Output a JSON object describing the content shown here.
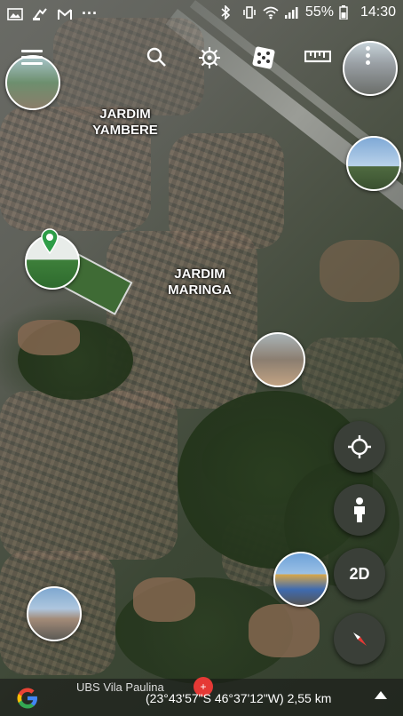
{
  "status_bar": {
    "battery": "55%",
    "time": "14:30",
    "overflow": "···"
  },
  "toolbar": {
    "icons": [
      "menu-icon",
      "search-icon",
      "voyager-icon",
      "feeling-lucky-icon",
      "measure-icon",
      "more-icon"
    ]
  },
  "map_labels": {
    "jardim_yambere": "JARDIM\nYAMBERE",
    "jardim_maringa": "JARDIM\nMARINGA"
  },
  "side_controls": {
    "locate_icon": "crosshair-icon",
    "street_view_icon": "pegman-icon",
    "view_mode": "2D",
    "compass_icon": "compass-icon"
  },
  "bottom_bar": {
    "poi_name": "UBS Vila Paulina",
    "coordinates": "(23°43'57\"S 46°37'12\"W) 2,55 km"
  },
  "colors": {
    "accent_google_blue": "#4285F4",
    "accent_google_red": "#EA4335",
    "accent_google_yellow": "#FBBC05",
    "accent_google_green": "#34A853",
    "fab_bg": "#3a3f38",
    "compass_red": "#e53935"
  }
}
